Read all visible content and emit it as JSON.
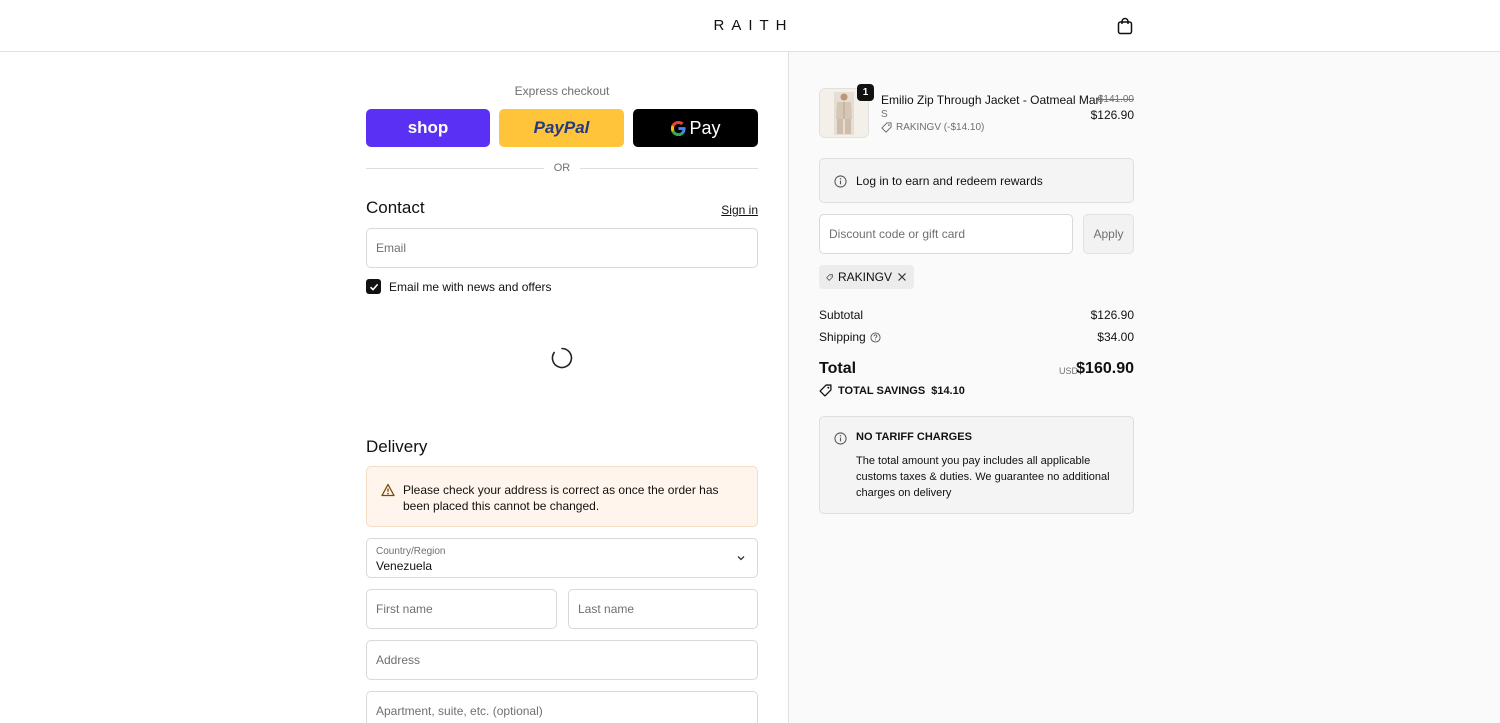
{
  "header": {
    "logo": "RAITH",
    "cart_icon": "shopping-bag-icon"
  },
  "express": {
    "title": "Express checkout",
    "shop_label": "shop",
    "paypal_label": "PayPal",
    "gpay_label": "Pay",
    "or_label": "OR"
  },
  "contact": {
    "title": "Contact",
    "signin_label": "Sign in",
    "email_placeholder": "Email",
    "newsletter_label": "Email me with news and offers",
    "newsletter_checked": true
  },
  "delivery": {
    "title": "Delivery",
    "notice": "Please check your address is correct as once the order has been placed this cannot be changed.",
    "country_label": "Country/Region",
    "country_value": "Venezuela",
    "first_name_placeholder": "First name",
    "last_name_placeholder": "Last name",
    "address_placeholder": "Address",
    "apartment_placeholder": "Apartment, suite, etc. (optional)"
  },
  "summary": {
    "item": {
      "title": "Emilio Zip Through Jacket - Oatmeal Marl",
      "variant": "S",
      "discount": "RAKINGV (-$14.10)",
      "old_price": "$141.00",
      "price": "$126.90",
      "quantity": "1"
    },
    "rewards": "Log in to earn and redeem rewards",
    "discount_placeholder": "Discount code or gift card",
    "apply_label": "Apply",
    "applied_code": "RAKINGV",
    "subtotal_label": "Subtotal",
    "subtotal_value": "$126.90",
    "shipping_label": "Shipping",
    "shipping_value": "$34.00",
    "total_label": "Total",
    "total_currency": "USD",
    "total_value": "$160.90",
    "savings_label": "TOTAL SAVINGS",
    "savings_value": "$14.10",
    "tariff_title": "NO TARIFF CHARGES",
    "tariff_body": "The total amount you pay includes all applicable customs taxes & duties. We guarantee no additional charges on delivery"
  },
  "colors": {
    "shop_purple": "#5a31f4",
    "paypal_yellow": "#ffc439",
    "gpay_black": "#000000",
    "notice_bg": "#fff5ec"
  }
}
